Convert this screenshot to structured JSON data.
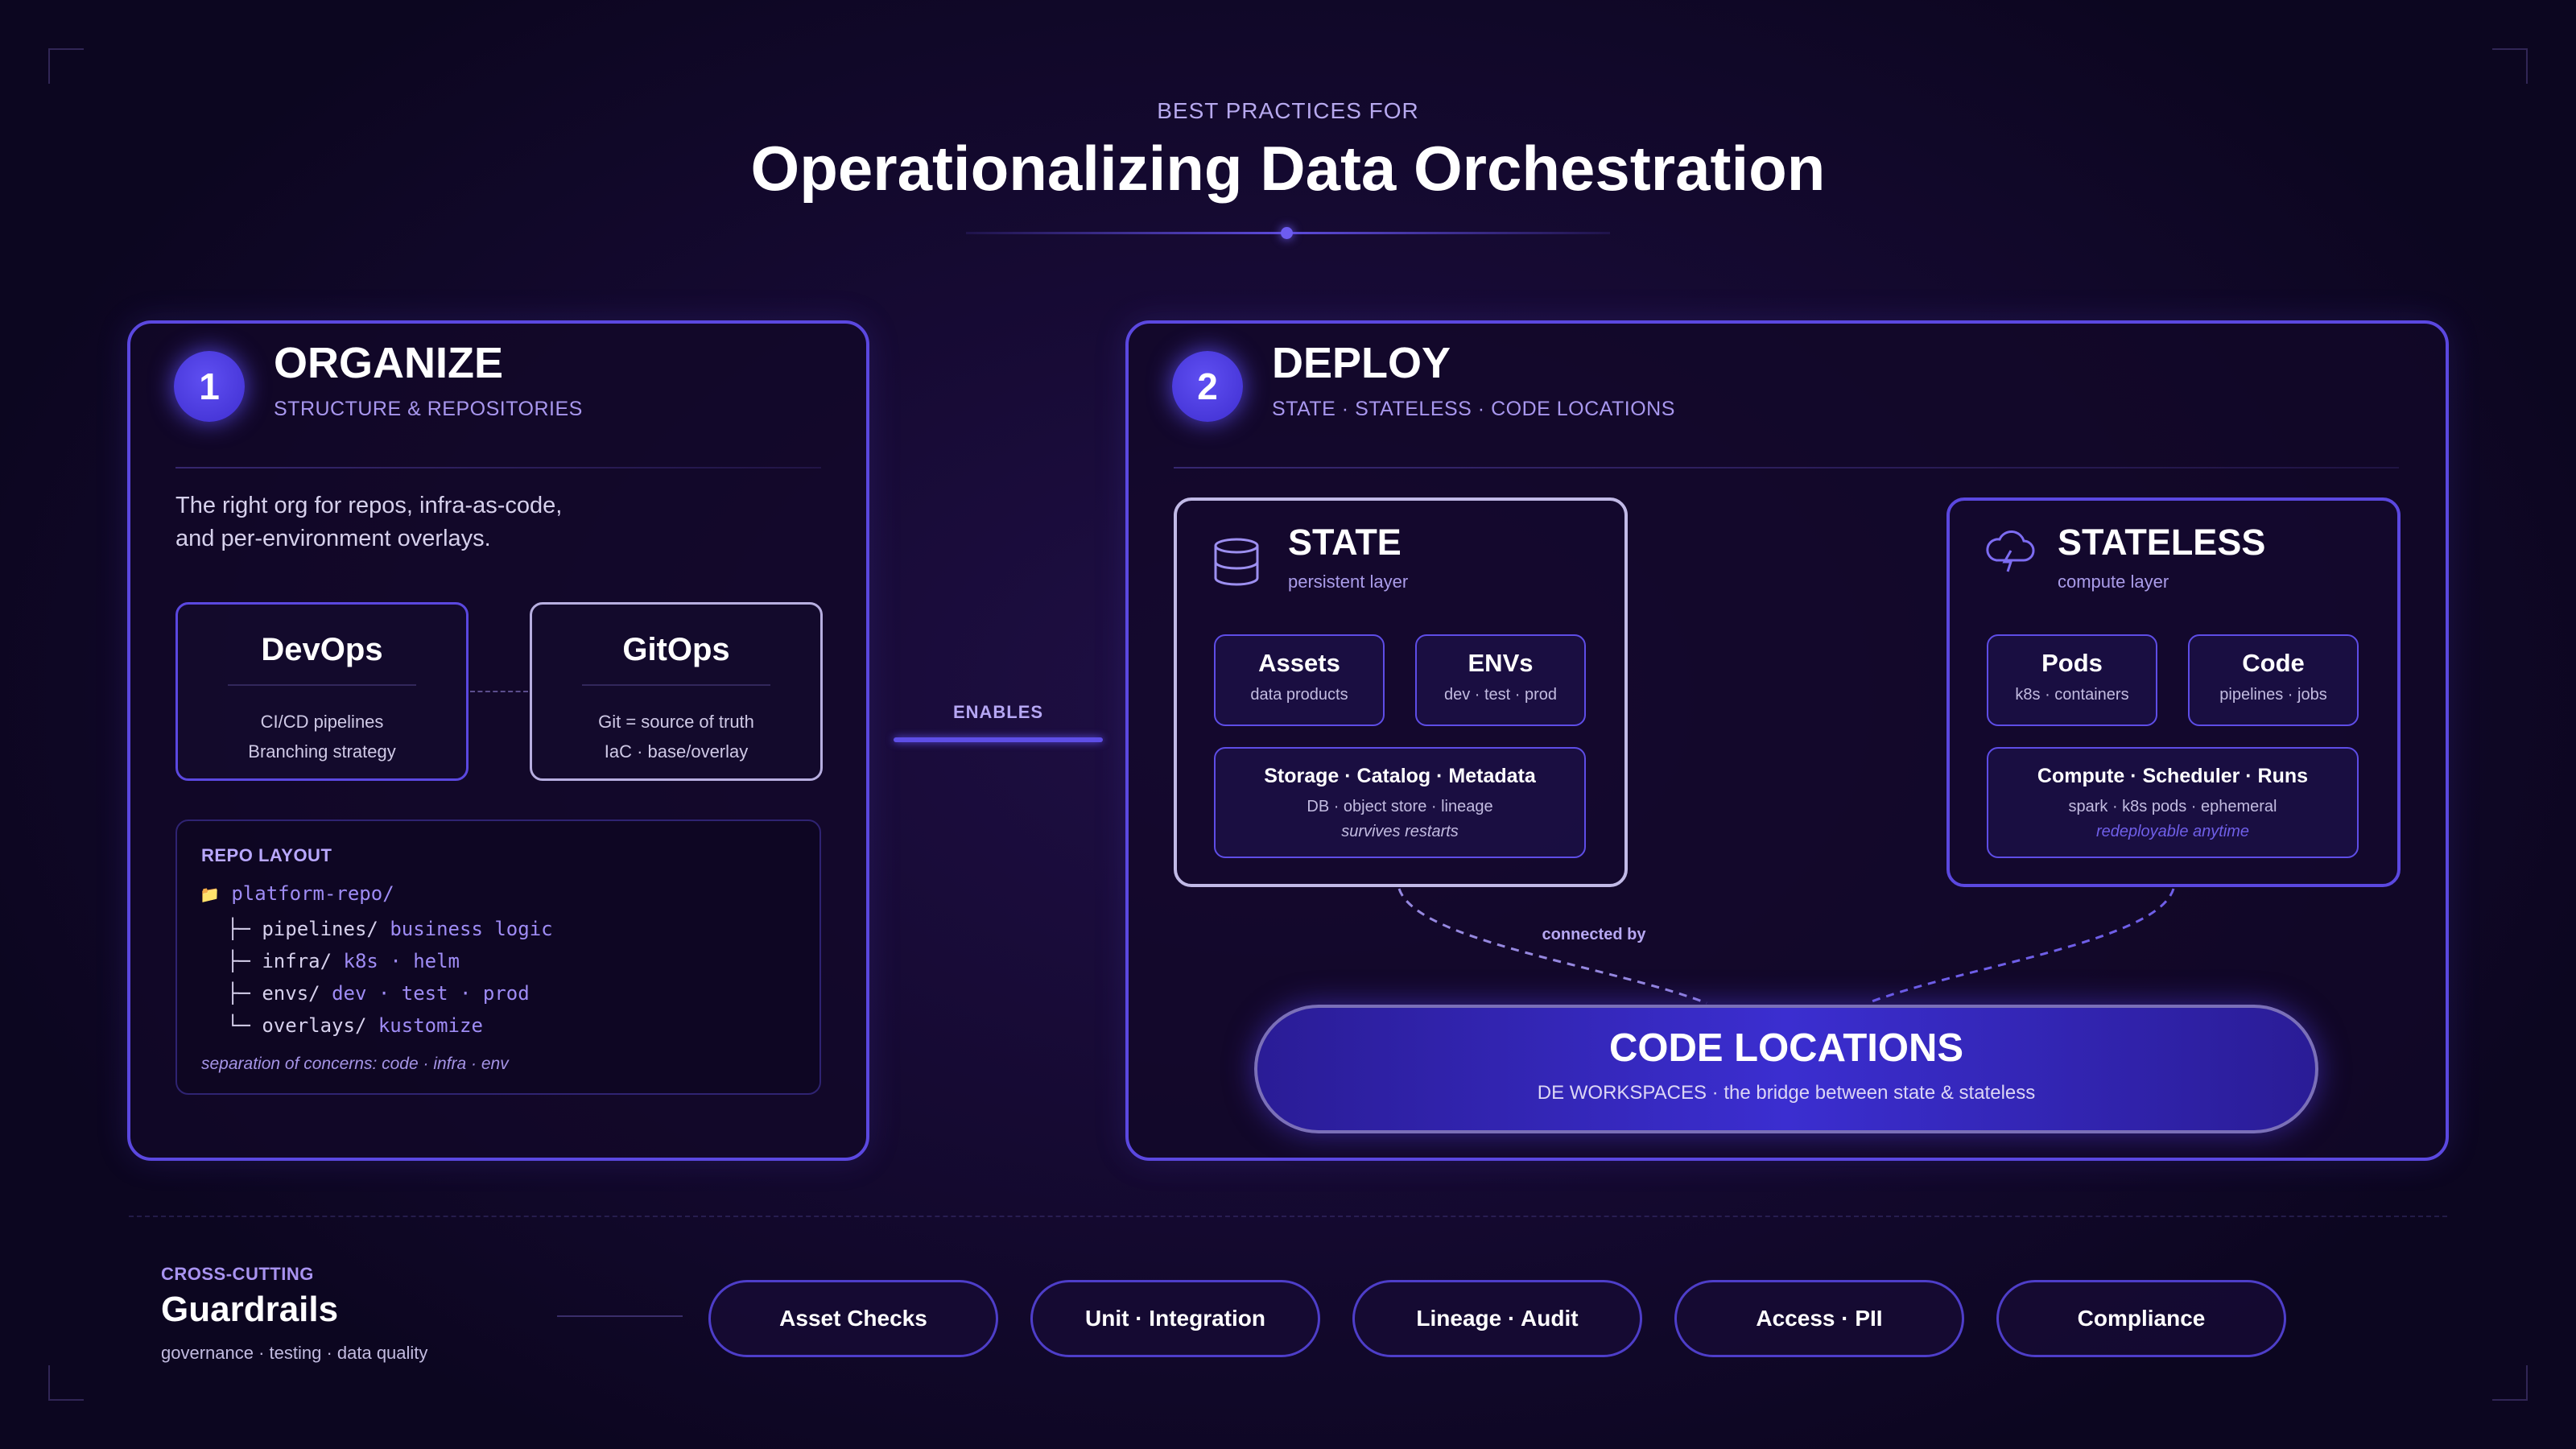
{
  "header": {
    "eyebrow": "BEST PRACTICES FOR",
    "title": "Operationalizing Data Orchestration"
  },
  "organize": {
    "number": "1",
    "title": "ORGANIZE",
    "subtitle": "STRUCTURE & REPOSITORIES",
    "intro_line1": "The right org for repos, infra-as-code,",
    "intro_line2": "and per-environment overlays.",
    "devops": {
      "title": "DevOps",
      "line1": "CI/CD pipelines",
      "line2": "Branching strategy"
    },
    "gitops": {
      "title": "GitOps",
      "line1": "Git = source of truth",
      "line2": "IaC · base/overlay"
    },
    "repo": {
      "label": "REPO LAYOUT",
      "root_icon": "📁",
      "root": "platform-repo/",
      "lines": [
        {
          "prefix": "├─",
          "dir": "pipelines/",
          "note": "business logic"
        },
        {
          "prefix": "├─",
          "dir": "infra/",
          "note": "k8s · helm"
        },
        {
          "prefix": "├─",
          "dir": "envs/",
          "note": "dev · test · prod"
        },
        {
          "prefix": "└─",
          "dir": "overlays/",
          "note": "kustomize"
        }
      ],
      "note": "separation of concerns: code · infra · env"
    }
  },
  "enables": "ENABLES",
  "deploy": {
    "number": "2",
    "title": "DEPLOY",
    "subtitle": "STATE · STATELESS · CODE LOCATIONS",
    "state": {
      "icon": "database-icon",
      "title": "STATE",
      "subtitle": "persistent layer",
      "tiles": [
        {
          "title": "Assets",
          "sub": "data products"
        },
        {
          "title": "ENVs",
          "sub": "dev · test · prod"
        }
      ],
      "wide": {
        "title": "Storage · Catalog · Metadata",
        "sub": "DB · object store · lineage",
        "note": "survives restarts"
      }
    },
    "stateless": {
      "icon": "cloud-bolt-icon",
      "title": "STATELESS",
      "subtitle": "compute layer",
      "tiles": [
        {
          "title": "Pods",
          "sub": "k8s · containers"
        },
        {
          "title": "Code",
          "sub": "pipelines · jobs"
        }
      ],
      "wide": {
        "title": "Compute · Scheduler · Runs",
        "sub": "spark · k8s pods · ephemeral",
        "note": "redeployable anytime"
      }
    },
    "connected_by": "connected by",
    "code_locations": {
      "title": "CODE LOCATIONS",
      "subtitle": "DE WORKSPACES · the bridge between state & stateless"
    }
  },
  "guardrails": {
    "label": "CROSS-CUTTING",
    "title": "Guardrails",
    "subtitle": "governance · testing · data quality",
    "pills": [
      "Asset Checks",
      "Unit · Integration",
      "Lineage · Audit",
      "Access · PII",
      "Compliance"
    ]
  },
  "colors": {
    "accent": "#5b48e0",
    "background": "#160a33",
    "muted_text": "#a897ee"
  }
}
